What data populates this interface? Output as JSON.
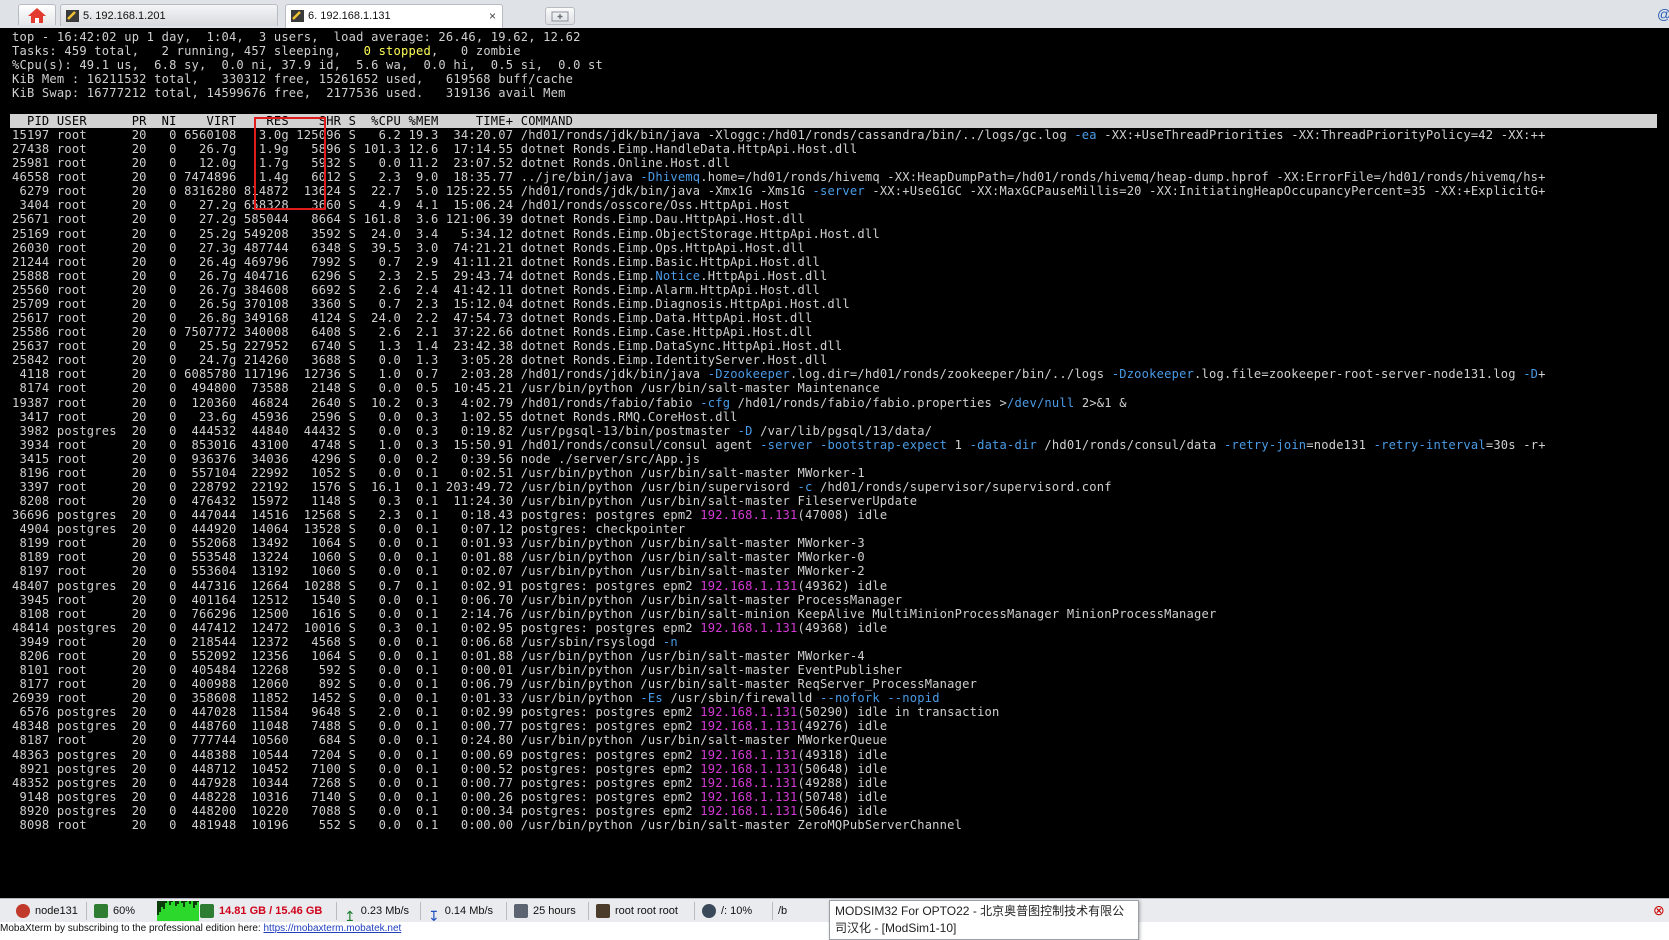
{
  "tabs": [
    {
      "label": "5. 192.168.1.201",
      "active": false
    },
    {
      "label": "6. 192.168.1.131",
      "active": true
    }
  ],
  "close_tab_glyph": "×",
  "summary": [
    "top - 16:42:02 up 1 day,  1:04,  3 users,  load average: 26.46, 19.62, 12.62",
    "Tasks: 459 total,   2 running, 457 sleeping,   0 stopped,   0 zombie",
    "%Cpu(s): 49.1 us,  6.8 sy,  0.0 ni, 37.9 id,  5.6 wa,  0.0 hi,  0.5 si,  0.0 st",
    "KiB Mem : 16211532 total,   330312 free, 15261652 used,   619568 buff/cache",
    "KiB Swap: 16777212 total, 14599676 free,  2177536 used.   319136 avail Mem"
  ],
  "header": "  PID USER      PR  NI    VIRT    RES    SHR S  %CPU %MEM     TIME+ COMMAND",
  "processes": [
    [
      "15197",
      "root",
      "20",
      "0",
      "6560108",
      "3.0g",
      "125096",
      "S",
      "6.2",
      "19.3",
      "34:20.07",
      "/hd01/ronds/jdk/bin/java -Xloggc:/hd01/ronds/cassandra/bin/../logs/gc.log -ea -XX:+UseThreadPriorities -XX:ThreadPriorityPolicy=42 -XX:++"
    ],
    [
      "27438",
      "root",
      "20",
      "0",
      "26.7g",
      "1.9g",
      "5896",
      "S",
      "101.3",
      "12.6",
      "17:14.55",
      "dotnet Ronds.Eimp.HandleData.HttpApi.Host.dll"
    ],
    [
      "25981",
      "root",
      "20",
      "0",
      "12.0g",
      "1.7g",
      "5932",
      "S",
      "0.0",
      "11.2",
      "23:07.52",
      "dotnet Ronds.Online.Host.dll"
    ],
    [
      "46558",
      "root",
      "20",
      "0",
      "7474896",
      "1.4g",
      "6012",
      "S",
      "2.3",
      "9.0",
      "18:35.77",
      "../jre/bin/java -Dhivemq.home=/hd01/ronds/hivemq -XX:HeapDumpPath=/hd01/ronds/hivemq/heap-dump.hprof -XX:ErrorFile=/hd01/ronds/hivemq/hs+"
    ],
    [
      "6279",
      "root",
      "20",
      "0",
      "8316280",
      "814872",
      "13624",
      "S",
      "22.7",
      "5.0",
      "125:22.55",
      "/hd01/ronds/jdk/bin/java -Xmx1G -Xms1G -server -XX:+UseG1GC -XX:MaxGCPauseMillis=20 -XX:InitiatingHeapOccupancyPercent=35 -XX:+ExplicitG+"
    ],
    [
      "3404",
      "root",
      "20",
      "0",
      "27.2g",
      "658328",
      "3660",
      "S",
      "4.9",
      "4.1",
      "15:06.24",
      "/hd01/ronds/osscore/Oss.HttpApi.Host"
    ],
    [
      "25671",
      "root",
      "20",
      "0",
      "27.2g",
      "585044",
      "8664",
      "S",
      "161.8",
      "3.6",
      "121:06.39",
      "dotnet Ronds.Eimp.Dau.HttpApi.Host.dll"
    ],
    [
      "25169",
      "root",
      "20",
      "0",
      "25.2g",
      "549208",
      "3592",
      "S",
      "24.0",
      "3.4",
      "5:34.12",
      "dotnet Ronds.Eimp.ObjectStorage.HttpApi.Host.dll"
    ],
    [
      "26030",
      "root",
      "20",
      "0",
      "27.3g",
      "487744",
      "6348",
      "S",
      "39.5",
      "3.0",
      "74:21.21",
      "dotnet Ronds.Eimp.Ops.HttpApi.Host.dll"
    ],
    [
      "21244",
      "root",
      "20",
      "0",
      "26.4g",
      "469796",
      "7992",
      "S",
      "0.7",
      "2.9",
      "41:11.21",
      "dotnet Ronds.Eimp.Basic.HttpApi.Host.dll"
    ],
    [
      "25888",
      "root",
      "20",
      "0",
      "26.7g",
      "404716",
      "6296",
      "S",
      "2.3",
      "2.5",
      "29:43.74",
      "dotnet Ronds.Eimp.Notice.HttpApi.Host.dll"
    ],
    [
      "25560",
      "root",
      "20",
      "0",
      "26.7g",
      "384608",
      "6692",
      "S",
      "2.6",
      "2.4",
      "41:42.11",
      "dotnet Ronds.Eimp.Alarm.HttpApi.Host.dll"
    ],
    [
      "25709",
      "root",
      "20",
      "0",
      "26.5g",
      "370108",
      "3360",
      "S",
      "0.7",
      "2.3",
      "15:12.04",
      "dotnet Ronds.Eimp.Diagnosis.HttpApi.Host.dll"
    ],
    [
      "25617",
      "root",
      "20",
      "0",
      "26.8g",
      "349168",
      "4124",
      "S",
      "24.0",
      "2.2",
      "47:54.73",
      "dotnet Ronds.Eimp.Data.HttpApi.Host.dll"
    ],
    [
      "25586",
      "root",
      "20",
      "0",
      "7507772",
      "340008",
      "6408",
      "S",
      "2.6",
      "2.1",
      "37:22.66",
      "dotnet Ronds.Eimp.Case.HttpApi.Host.dll"
    ],
    [
      "25637",
      "root",
      "20",
      "0",
      "25.5g",
      "227952",
      "6740",
      "S",
      "1.3",
      "1.4",
      "23:42.38",
      "dotnet Ronds.Eimp.DataSync.HttpApi.Host.dll"
    ],
    [
      "25842",
      "root",
      "20",
      "0",
      "24.7g",
      "214260",
      "3688",
      "S",
      "0.0",
      "1.3",
      "3:05.28",
      "dotnet Ronds.Eimp.IdentityServer.Host.dll"
    ],
    [
      "4118",
      "root",
      "20",
      "0",
      "6085780",
      "117196",
      "12736",
      "S",
      "1.0",
      "0.7",
      "2:03.28",
      "/hd01/ronds/jdk/bin/java -Dzookeeper.log.dir=/hd01/ronds/zookeeper/bin/../logs -Dzookeeper.log.file=zookeeper-root-server-node131.log -D+"
    ],
    [
      "8174",
      "root",
      "20",
      "0",
      "494800",
      "73588",
      "2148",
      "S",
      "0.0",
      "0.5",
      "10:45.21",
      "/usr/bin/python /usr/bin/salt-master Maintenance"
    ],
    [
      "19387",
      "root",
      "20",
      "0",
      "120360",
      "46824",
      "2640",
      "S",
      "10.2",
      "0.3",
      "4:02.79",
      "/hd01/ronds/fabio/fabio -cfg /hd01/ronds/fabio/fabio.properties >/dev/null 2>&1 &"
    ],
    [
      "3417",
      "root",
      "20",
      "0",
      "23.6g",
      "45936",
      "2596",
      "S",
      "0.0",
      "0.3",
      "1:02.55",
      "dotnet Ronds.RMQ.CoreHost.dll"
    ],
    [
      "3982",
      "postgres",
      "20",
      "0",
      "444532",
      "44840",
      "44432",
      "S",
      "0.0",
      "0.3",
      "0:19.82",
      "/usr/pgsql-13/bin/postmaster -D /var/lib/pgsql/13/data/"
    ],
    [
      "3934",
      "root",
      "20",
      "0",
      "853016",
      "43100",
      "4748",
      "S",
      "1.0",
      "0.3",
      "15:50.91",
      "/hd01/ronds/consul/consul agent -server -bootstrap-expect 1 -data-dir /hd01/ronds/consul/data -retry-join=node131 -retry-interval=30s -r+"
    ],
    [
      "3415",
      "root",
      "20",
      "0",
      "936376",
      "34036",
      "4296",
      "S",
      "0.0",
      "0.2",
      "0:39.56",
      "node ./server/src/App.js"
    ],
    [
      "8196",
      "root",
      "20",
      "0",
      "557104",
      "22992",
      "1052",
      "S",
      "0.0",
      "0.1",
      "0:02.51",
      "/usr/bin/python /usr/bin/salt-master MWorker-1"
    ],
    [
      "3397",
      "root",
      "20",
      "0",
      "228792",
      "22192",
      "1576",
      "S",
      "16.1",
      "0.1",
      "203:49.72",
      "/usr/bin/python /usr/bin/supervisord -c /hd01/ronds/supervisor/supervisord.conf"
    ],
    [
      "8208",
      "root",
      "20",
      "0",
      "476432",
      "15972",
      "1148",
      "S",
      "0.3",
      "0.1",
      "11:24.30",
      "/usr/bin/python /usr/bin/salt-master FileserverUpdate"
    ],
    [
      "36696",
      "postgres",
      "20",
      "0",
      "447044",
      "14516",
      "12568",
      "S",
      "2.3",
      "0.1",
      "0:18.43",
      "postgres: postgres epm2 192.168.1.131(47008) idle"
    ],
    [
      "4904",
      "postgres",
      "20",
      "0",
      "444920",
      "14064",
      "13528",
      "S",
      "0.0",
      "0.1",
      "0:07.12",
      "postgres: checkpointer"
    ],
    [
      "8199",
      "root",
      "20",
      "0",
      "552068",
      "13492",
      "1064",
      "S",
      "0.0",
      "0.1",
      "0:01.93",
      "/usr/bin/python /usr/bin/salt-master MWorker-3"
    ],
    [
      "8189",
      "root",
      "20",
      "0",
      "553548",
      "13224",
      "1060",
      "S",
      "0.0",
      "0.1",
      "0:01.88",
      "/usr/bin/python /usr/bin/salt-master MWorker-0"
    ],
    [
      "8197",
      "root",
      "20",
      "0",
      "553604",
      "13192",
      "1060",
      "S",
      "0.0",
      "0.1",
      "0:02.07",
      "/usr/bin/python /usr/bin/salt-master MWorker-2"
    ],
    [
      "48407",
      "postgres",
      "20",
      "0",
      "447316",
      "12664",
      "10288",
      "S",
      "0.7",
      "0.1",
      "0:02.91",
      "postgres: postgres epm2 192.168.1.131(49362) idle"
    ],
    [
      "3945",
      "root",
      "20",
      "0",
      "401164",
      "12512",
      "1540",
      "S",
      "0.0",
      "0.1",
      "0:06.70",
      "/usr/bin/python /usr/bin/salt-master ProcessManager"
    ],
    [
      "8108",
      "root",
      "20",
      "0",
      "766296",
      "12500",
      "1616",
      "S",
      "0.0",
      "0.1",
      "2:14.76",
      "/usr/bin/python /usr/bin/salt-minion KeepAlive MultiMinionProcessManager MinionProcessManager"
    ],
    [
      "48414",
      "postgres",
      "20",
      "0",
      "447412",
      "12472",
      "10016",
      "S",
      "0.3",
      "0.1",
      "0:02.95",
      "postgres: postgres epm2 192.168.1.131(49368) idle"
    ],
    [
      "3949",
      "root",
      "20",
      "0",
      "218544",
      "12372",
      "4568",
      "S",
      "0.0",
      "0.1",
      "0:06.68",
      "/usr/sbin/rsyslogd -n"
    ],
    [
      "8206",
      "root",
      "20",
      "0",
      "552092",
      "12356",
      "1064",
      "S",
      "0.0",
      "0.1",
      "0:01.88",
      "/usr/bin/python /usr/bin/salt-master MWorker-4"
    ],
    [
      "8101",
      "root",
      "20",
      "0",
      "405484",
      "12268",
      "592",
      "S",
      "0.0",
      "0.1",
      "0:00.01",
      "/usr/bin/python /usr/bin/salt-master EventPublisher"
    ],
    [
      "8177",
      "root",
      "20",
      "0",
      "400988",
      "12060",
      "892",
      "S",
      "0.0",
      "0.1",
      "0:06.79",
      "/usr/bin/python /usr/bin/salt-master ReqServer_ProcessManager"
    ],
    [
      "26939",
      "root",
      "20",
      "0",
      "358608",
      "11852",
      "1452",
      "S",
      "0.0",
      "0.1",
      "0:01.33",
      "/usr/bin/python -Es /usr/sbin/firewalld --nofork --nopid"
    ],
    [
      "6576",
      "postgres",
      "20",
      "0",
      "447028",
      "11584",
      "9648",
      "S",
      "2.0",
      "0.1",
      "0:02.99",
      "postgres: postgres epm2 192.168.1.131(50290) idle in transaction"
    ],
    [
      "48348",
      "postgres",
      "20",
      "0",
      "448760",
      "11048",
      "7488",
      "S",
      "0.0",
      "0.1",
      "0:00.77",
      "postgres: postgres epm2 192.168.1.131(49276) idle"
    ],
    [
      "8187",
      "root",
      "20",
      "0",
      "777744",
      "10560",
      "684",
      "S",
      "0.0",
      "0.1",
      "0:24.80",
      "/usr/bin/python /usr/bin/salt-master MWorkerQueue"
    ],
    [
      "48363",
      "postgres",
      "20",
      "0",
      "448388",
      "10544",
      "7204",
      "S",
      "0.0",
      "0.1",
      "0:00.69",
      "postgres: postgres epm2 192.168.1.131(49318) idle"
    ],
    [
      "8921",
      "postgres",
      "20",
      "0",
      "448712",
      "10452",
      "7100",
      "S",
      "0.0",
      "0.1",
      "0:00.52",
      "postgres: postgres epm2 192.168.1.131(50648) idle"
    ],
    [
      "48352",
      "postgres",
      "20",
      "0",
      "447928",
      "10344",
      "7268",
      "S",
      "0.0",
      "0.1",
      "0:00.77",
      "postgres: postgres epm2 192.168.1.131(49288) idle"
    ],
    [
      "9148",
      "postgres",
      "20",
      "0",
      "448228",
      "10316",
      "7140",
      "S",
      "0.0",
      "0.1",
      "0:00.26",
      "postgres: postgres epm2 192.168.1.131(50748) idle"
    ],
    [
      "8920",
      "postgres",
      "20",
      "0",
      "448200",
      "10220",
      "7088",
      "S",
      "0.0",
      "0.1",
      "0:00.34",
      "postgres: postgres epm2 192.168.1.131(50646) idle"
    ],
    [
      "8098",
      "root",
      "20",
      "0",
      "481948",
      "10196",
      "552",
      "S",
      "0.0",
      "0.1",
      "0:00.00",
      "/usr/bin/python /usr/bin/salt-master ZeroMQPubServerChannel"
    ]
  ],
  "status": {
    "host": "node131",
    "cpu": "60%",
    "memory": "14.81 GB / 15.46 GB",
    "upload": "0.23 Mb/s",
    "download": "0.14 Mb/s",
    "uptime": "25 hours",
    "users": "root  root  root",
    "disk": "/: 10%",
    "more": "/b"
  },
  "footer": {
    "text": "MobaXterm by subscribing to the professional edition here: ",
    "link": "https://mobaxterm.mobatek.net"
  },
  "popup": {
    "line1": "MODSIM32 For OPTO22 - 北京奥普图控制技术有限公",
    "line2": "司汉化 - [ModSim1-10]"
  },
  "colors": {
    "opt_flag": "#4a9be6",
    "ip": "#d33ad3",
    "stopped": "#ffff55",
    "highlight_box": "#e01b1b",
    "mem_status": "#d0021b"
  }
}
